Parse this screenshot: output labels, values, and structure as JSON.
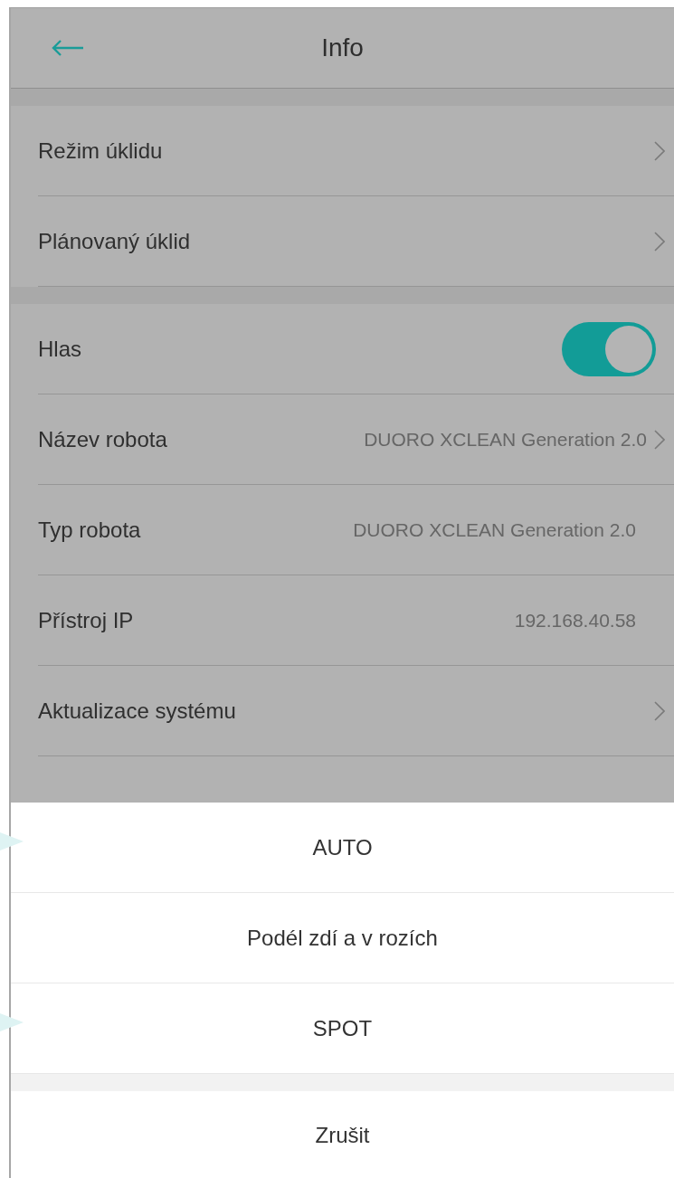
{
  "header": {
    "title": "Info"
  },
  "groups": [
    {
      "rows": [
        {
          "kind": "link",
          "label": "Režim úklidu"
        },
        {
          "kind": "link",
          "label": "Plánovaný úklid"
        }
      ]
    },
    {
      "rows": [
        {
          "kind": "toggle",
          "label": "Hlas",
          "on": true
        },
        {
          "kind": "link",
          "label": "Název robota",
          "value": "DUORO XCLEAN Generation 2.0"
        },
        {
          "kind": "info",
          "label": "Typ robota",
          "value": "DUORO XCLEAN Generation 2.0"
        },
        {
          "kind": "info",
          "label": "Přístroj IP",
          "value": "192.168.40.58"
        },
        {
          "kind": "link",
          "label": "Aktualizace systému"
        }
      ]
    }
  ],
  "action_sheet": {
    "options": [
      "AUTO",
      "Podél zdí a v rozích",
      "SPOT"
    ],
    "cancel": "Zrušit"
  },
  "pointers": [
    {
      "kind": "pointer"
    },
    {
      "kind": "pointer"
    }
  ]
}
